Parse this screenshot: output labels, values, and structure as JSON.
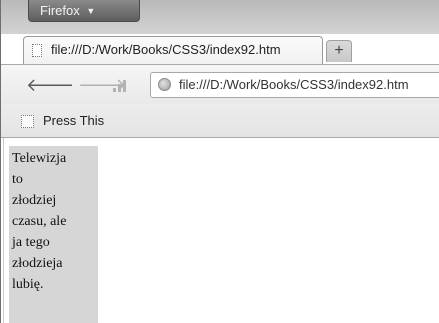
{
  "browser": {
    "menu_button": "Firefox",
    "tab_title": "file:///D:/Work/Books/CSS3/index92.htm",
    "new_tab_symbol": "+",
    "url": "file:///D:/Work/Books/CSS3/index92.htm"
  },
  "nav": {
    "back_icon": "back-arrow-icon",
    "forward_icon": "forward-arrow-icon",
    "signal_icon": "signal-bars-icon",
    "site_icon": "globe-icon"
  },
  "bookmarks": {
    "items": [
      {
        "label": "Press This",
        "icon": "page-icon"
      }
    ]
  },
  "page": {
    "lines": [
      "Telewizja",
      "to",
      "złodziej",
      "czasu, ale",
      "ja tego",
      "złodzieja",
      "lubię."
    ],
    "box_color": "#d6d6d6"
  }
}
